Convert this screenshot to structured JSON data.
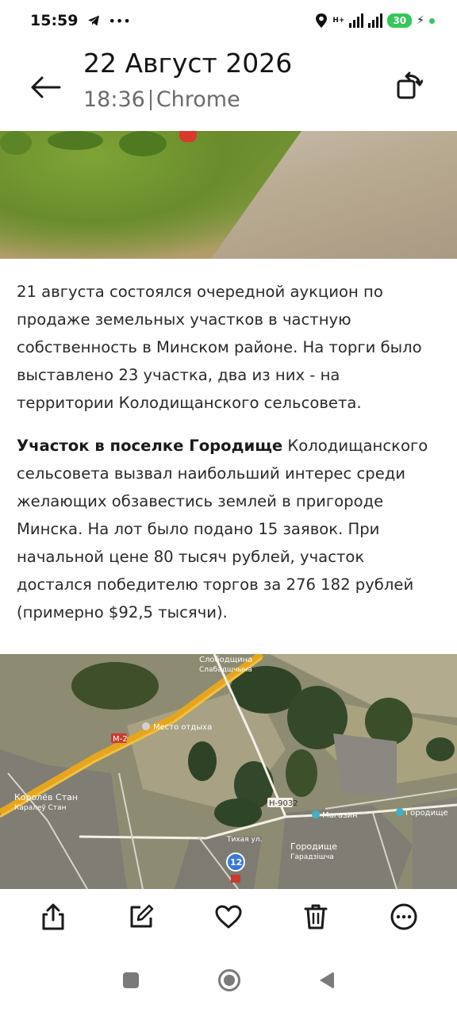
{
  "status_bar": {
    "time": "15:59",
    "icons": [
      "telegram-icon",
      "more-icon"
    ],
    "network_label": "H+",
    "battery": "30"
  },
  "header": {
    "date": "22 Август 2026",
    "time": "18:36",
    "source": "Chrome"
  },
  "article": {
    "para1": "21 августа состоялся очередной аукцион по продаже земельных участков в частную собственность в Минском районе. На торги было выставлено 23 участка, два из них - на территории Колодищанского сельсовета.",
    "para2_bold": "Участок в поселке Городище",
    "para2_rest": " Колодищанского сельсовета вызвал наибольший интерес среди желающих обзавестись землей в пригороде Минска. На лот было подано 15 заявок. При начальной цене 80 тысяч рублей, участок достался победителю торгов за 276 182 рублей (примерно $92,5 тысячи)."
  },
  "map": {
    "labels": {
      "slobodshchina": "Слободщина",
      "slobodshchina_by": "Слабадшчына",
      "mesto_otdykha": "Место отдыха",
      "road_m2": "М-2",
      "korolev_stan": "Королёв Стан",
      "karalew_stan": "Каралеў Стан",
      "road_h9032": "Н-9032",
      "magazin": "Магазин",
      "gorodishche": "Городище",
      "gorodishche_top": "Городище",
      "garadzishcha": "Гарадзішча",
      "tikhaya_ul": "Тихая ул.",
      "marker": "12"
    }
  },
  "actions": [
    "share-icon",
    "edit-icon",
    "favorite-icon",
    "delete-icon",
    "more-options-icon"
  ],
  "colors": {
    "battery": "#34c759",
    "marker": "#3a78d8"
  }
}
